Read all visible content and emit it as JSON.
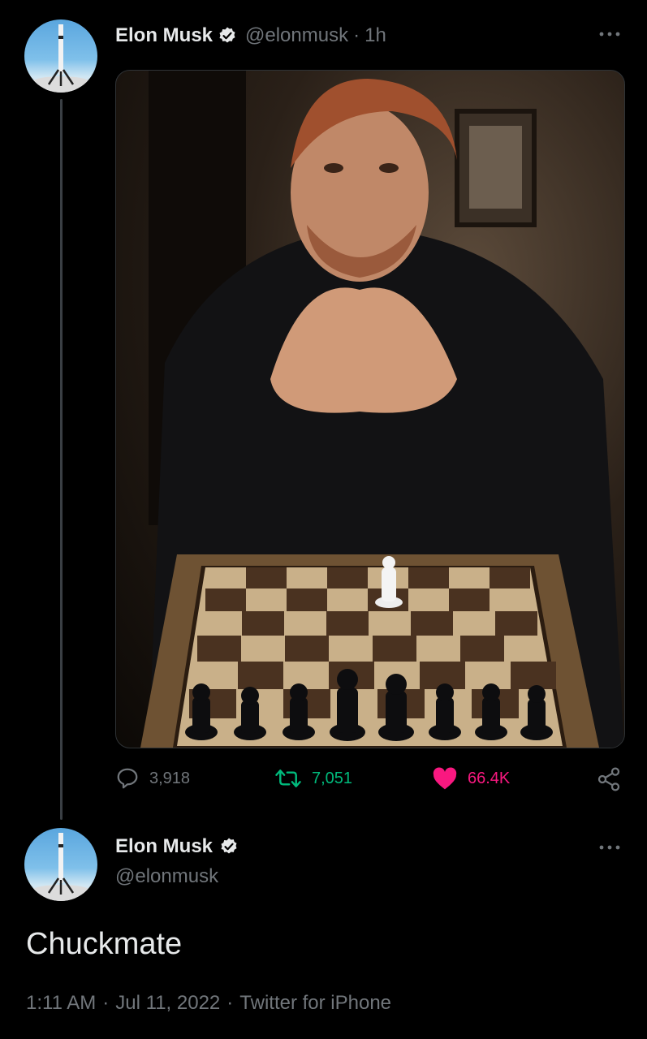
{
  "retweeted_post": {
    "author_name": "Elon Musk",
    "author_handle": "@elonmusk",
    "separator": "·",
    "time_ago": "1h",
    "more_icon": "more-horizontal-icon",
    "media_image": "chess-photo-man-with-board",
    "actions": {
      "reply_count": "3,918",
      "retweet_count": "7,051",
      "like_count": "66.4K"
    },
    "colors": {
      "retweet": "#00ba7c",
      "like": "#f91880",
      "muted": "#71767b"
    }
  },
  "reply_post": {
    "author_name": "Elon Musk",
    "author_handle": "@elonmusk",
    "text": "Chuckmate",
    "time": "1:11 AM",
    "separator": "·",
    "date": "Jul 11, 2022",
    "source": "Twitter for iPhone"
  }
}
